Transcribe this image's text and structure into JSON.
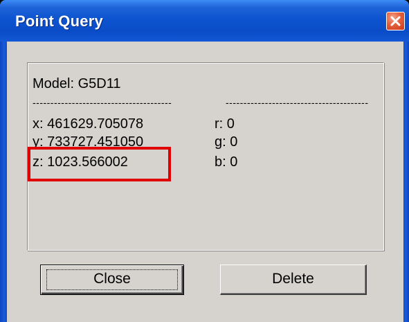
{
  "window": {
    "title": "Point Query"
  },
  "query": {
    "model_line": "Model: G5D11",
    "separator_left": "---------------------------------------",
    "separator_right": "----------------------------------------",
    "x_line": "x: 461629.705078",
    "y_line": "y: 733727.451050",
    "z_line": "z: 1023.566002",
    "r_line": "r: 0",
    "g_line": "g: 0",
    "b_line": "b: 0"
  },
  "buttons": {
    "close_label": "Close",
    "delete_label": "Delete"
  },
  "icons": {
    "title_close": "close-icon"
  },
  "colors": {
    "titlebar": "#0a4cc6",
    "client": "#d6d3ce",
    "highlight": "#e00000",
    "close_button": "#e3603c"
  }
}
